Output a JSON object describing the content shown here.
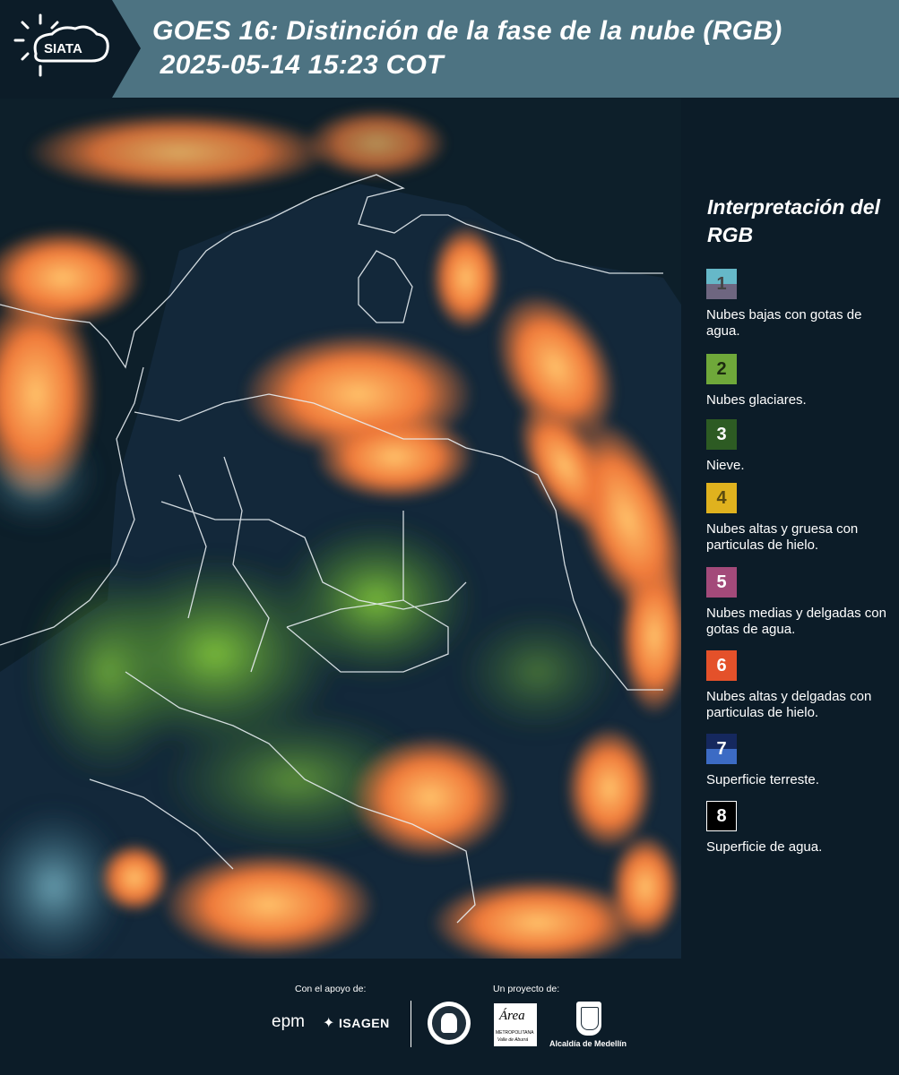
{
  "header": {
    "logo_text": "SIATA",
    "title_line1": "GOES 16: Distinción de la fase de la nube (RGB)",
    "title_line2": " 2025-05-14 15:23 COT"
  },
  "legend": {
    "title": "Interpretación del RGB",
    "items": [
      {
        "number": "1",
        "label": "Nubes bajas con gotas de agua.",
        "color_top": "#66b8c8",
        "color_bottom": "#6e6680"
      },
      {
        "number": "2",
        "label": "Nubes glaciares.",
        "color": "#6fa83a"
      },
      {
        "number": "3",
        "label": "Nieve.",
        "color": "#2d5b23"
      },
      {
        "number": "4",
        "label": "Nubes altas y gruesa con particulas de hielo.",
        "color": "#e0b21e"
      },
      {
        "number": "5",
        "label": "Nubes medias y delgadas con gotas de agua.",
        "color": "#a34a7a"
      },
      {
        "number": "6",
        "label": "Nubes altas y delgadas con particulas de hielo.",
        "color": "#e4512a"
      },
      {
        "number": "7",
        "label": "Superficie terreste.",
        "color_top": "#15285e",
        "color_bottom": "#3c6bc4"
      },
      {
        "number": "8",
        "label": "Superficie de agua.",
        "color": "#000000"
      }
    ]
  },
  "footer": {
    "support_label": "Con el apoyo de:",
    "project_label": "Un proyecto de:",
    "sponsor_epm": "epm",
    "sponsor_isagen": "ISAGEN",
    "area_logo_text": "Área",
    "area_subtext": "METROPOLITANA",
    "area_subtext2": "Valle de Aburrá",
    "alcaldia": "Alcaldía de Medellín"
  }
}
